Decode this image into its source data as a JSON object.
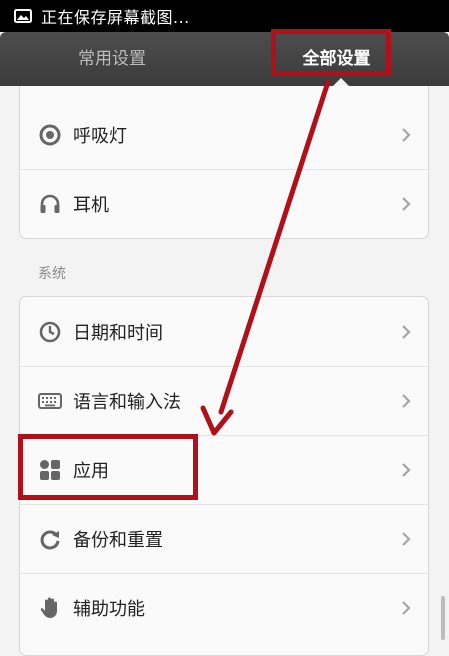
{
  "status_bar": {
    "text": "正在保存屏幕截图...",
    "icon": "picture-icon"
  },
  "tabs": [
    {
      "label": "常用设置",
      "active": false
    },
    {
      "label": "全部设置",
      "active": true
    }
  ],
  "group1": {
    "items": [
      {
        "label": "呼吸灯",
        "icon": "breathing-light-icon"
      },
      {
        "label": "耳机",
        "icon": "headphones-icon"
      }
    ]
  },
  "system_section": {
    "header": "系统",
    "items": [
      {
        "label": "日期和时间",
        "icon": "clock-icon"
      },
      {
        "label": "语言和输入法",
        "icon": "keyboard-icon"
      },
      {
        "label": "应用",
        "icon": "apps-icon"
      },
      {
        "label": "备份和重置",
        "icon": "backup-icon"
      },
      {
        "label": "辅助功能",
        "icon": "hand-icon"
      }
    ]
  },
  "colors": {
    "highlight": "#b0101a",
    "tabbar": "#444444",
    "background": "#f3f3f3"
  }
}
